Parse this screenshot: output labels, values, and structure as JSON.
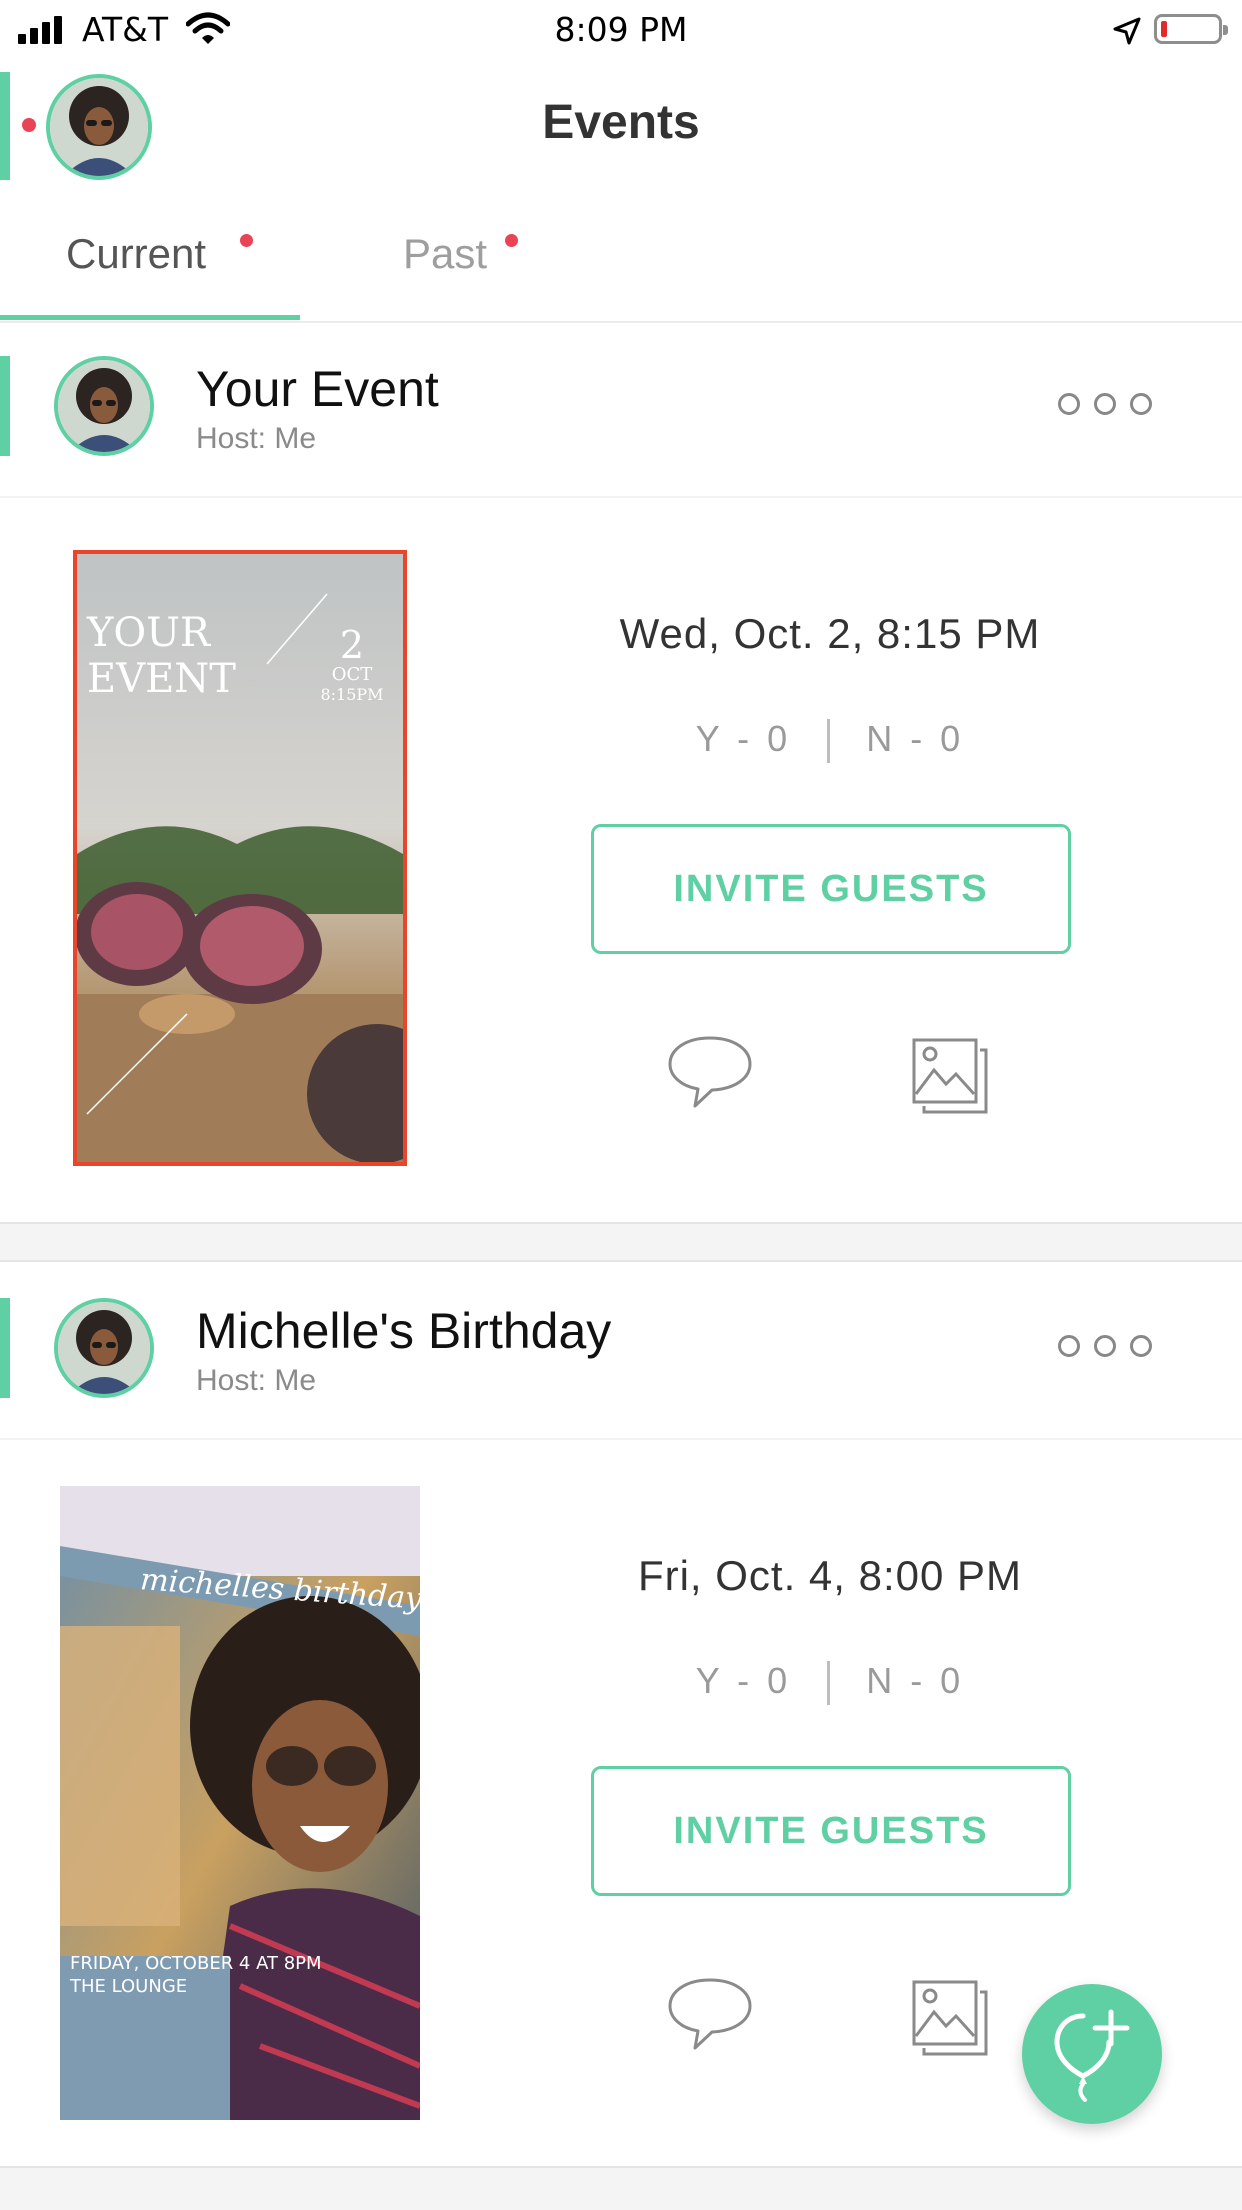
{
  "status_bar": {
    "carrier": "AT&T",
    "time": "8:09 PM"
  },
  "header": {
    "title": "Events"
  },
  "tabs": [
    {
      "label": "Current",
      "active": true
    },
    {
      "label": "Past",
      "active": false
    }
  ],
  "events": [
    {
      "title": "Your Event",
      "host": "Host: Me",
      "date": "Wed, Oct. 2, 8:15 PM",
      "rsvp_yes": "Y - 0",
      "rsvp_no": "N - 0",
      "invite_label": "INVITE GUESTS",
      "poster": {
        "line1": "YOUR",
        "line2": "EVENT",
        "day": "2",
        "month": "OCT",
        "time": "8:15PM"
      }
    },
    {
      "title": "Michelle's Birthday",
      "host": "Host: Me",
      "date": "Fri, Oct. 4, 8:00 PM",
      "rsvp_yes": "Y - 0",
      "rsvp_no": "N - 0",
      "invite_label": "INVITE GUESTS",
      "poster": {
        "script_title": "michelles birthday",
        "caption_line1": "FRIDAY, OCTOBER 4 AT 8PM",
        "caption_line2": "THE LOUNGE"
      }
    }
  ],
  "colors": {
    "accent": "#5fcfa4",
    "notification": "#e94456",
    "poster_border": "#e8452a"
  }
}
